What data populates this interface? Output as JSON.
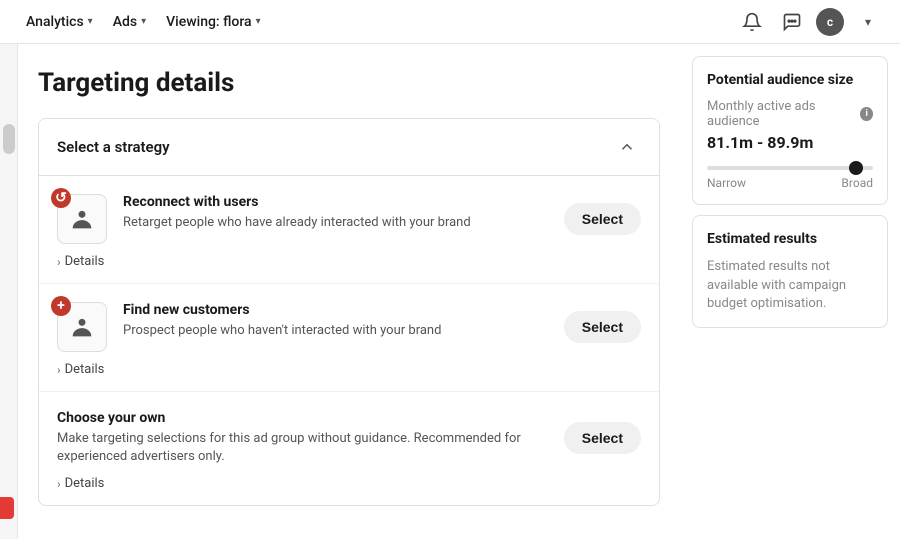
{
  "nav": {
    "items": [
      {
        "label": "Analytics",
        "id": "analytics"
      },
      {
        "label": "Ads",
        "id": "ads"
      },
      {
        "label": "Viewing: flora",
        "id": "viewing"
      }
    ],
    "avatar_label": "c",
    "chevron_char": "▾"
  },
  "page": {
    "title": "Targeting details"
  },
  "strategy_section": {
    "header": "Select a strategy",
    "options": [
      {
        "id": "reconnect",
        "title": "Reconnect with users",
        "description": "Retarget people who have already interacted with your brand",
        "badge": "↺",
        "badge_class": "red",
        "select_label": "Select",
        "details_label": "Details"
      },
      {
        "id": "find-new",
        "title": "Find new customers",
        "description": "Prospect people who haven't interacted with your brand",
        "badge": "+",
        "badge_class": "red-plus",
        "select_label": "Select",
        "details_label": "Details"
      },
      {
        "id": "choose-own",
        "title": "Choose your own",
        "description": "Make targeting selections for this ad group without guidance. Recommended for experienced advertisers only.",
        "badge": null,
        "badge_class": "",
        "select_label": "Select",
        "details_label": "Details"
      }
    ]
  },
  "audience_card": {
    "title": "Potential audience size",
    "monthly_label": "Monthly active ads audience",
    "range": "81.1m - 89.9m",
    "slider_narrow": "Narrow",
    "slider_broad": "Broad"
  },
  "estimated_card": {
    "title": "Estimated results",
    "description": "Estimated results not available with campaign budget optimisation."
  }
}
